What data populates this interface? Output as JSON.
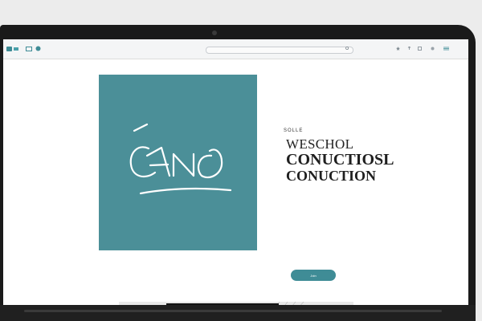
{
  "browser": {
    "tabs": [
      "",
      "",
      ""
    ],
    "url": "",
    "toolbar_icons": [
      "search-icon",
      "star-icon",
      "share-icon",
      "menu-icon"
    ]
  },
  "hero": {
    "logo_text": "CANO",
    "tile_color": "#4b8f98"
  },
  "content": {
    "kicker": "SOLLE",
    "title_line1": "WESCHOL",
    "title_line2": "CONUCTIOSL",
    "title_line3": "CONUCTION",
    "tagline": "",
    "body_lines": [
      "",
      ""
    ],
    "cta_label": "Join",
    "accent_color": "#3f8c96"
  }
}
